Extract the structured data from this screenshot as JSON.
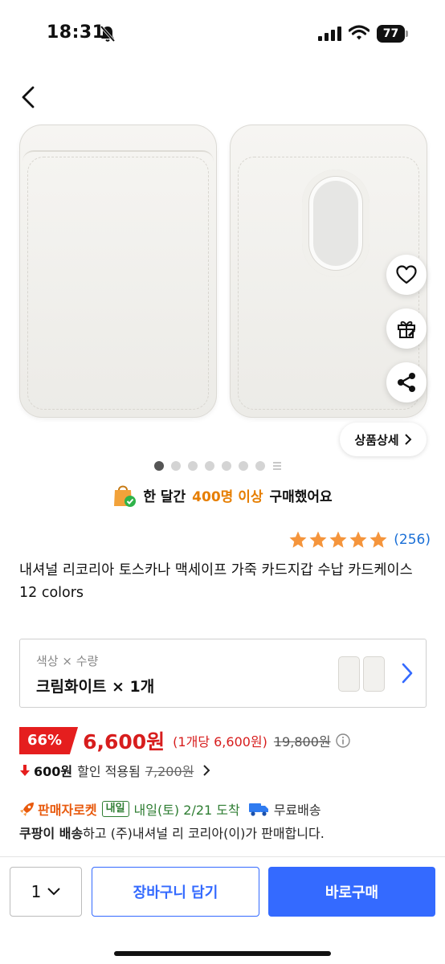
{
  "status_bar": {
    "time": "18:31",
    "battery": "77"
  },
  "nav": {
    "back_icon": "chevron-left-icon"
  },
  "floating_actions": {
    "wishlist_icon": "heart-icon",
    "gift_icon": "gift-icon",
    "share_icon": "share-icon"
  },
  "detail_button": {
    "label": "상품상세"
  },
  "carousel": {
    "total": 7,
    "active_index": 0
  },
  "purchase_banner": {
    "prefix": "한 달간",
    "highlight": "400명 이상",
    "suffix": "구매했어요"
  },
  "rating": {
    "stars": 5,
    "review_count": "(256)"
  },
  "product": {
    "title": "내셔널 리코리아 토스카나 맥세이프 가죽 카드지갑 수납 카드케이스 12 colors"
  },
  "option": {
    "label": "색상 × 수량",
    "value": "크림화이트 × 1개"
  },
  "price": {
    "discount_rate": "66%",
    "sale_price": "6,600원",
    "unit_price": "(1개당 6,600원)",
    "original_price": "19,800원"
  },
  "discount": {
    "amount": "600원",
    "text": "할인 적용됨",
    "before_price": "7,200원"
  },
  "shipping": {
    "rocket_label": "판매자로켓",
    "tomorrow_badge": "내일",
    "arrival": "내일(토) 2/21 도착",
    "free_shipping": "무료배송"
  },
  "seller": {
    "strong": "쿠팡이 배송",
    "text": "하고 (주)내셔널 리 코리아(이)가 판매합니다."
  },
  "bottom_bar": {
    "quantity": "1",
    "cart_label": "장바구니 담기",
    "buy_label": "바로구매"
  },
  "colors": {
    "accent_blue": "#346aff",
    "price_red": "#d71d1d",
    "star_orange": "#f5953c",
    "rocket_orange": "#e8590c",
    "delivery_green": "#2e7d32"
  }
}
